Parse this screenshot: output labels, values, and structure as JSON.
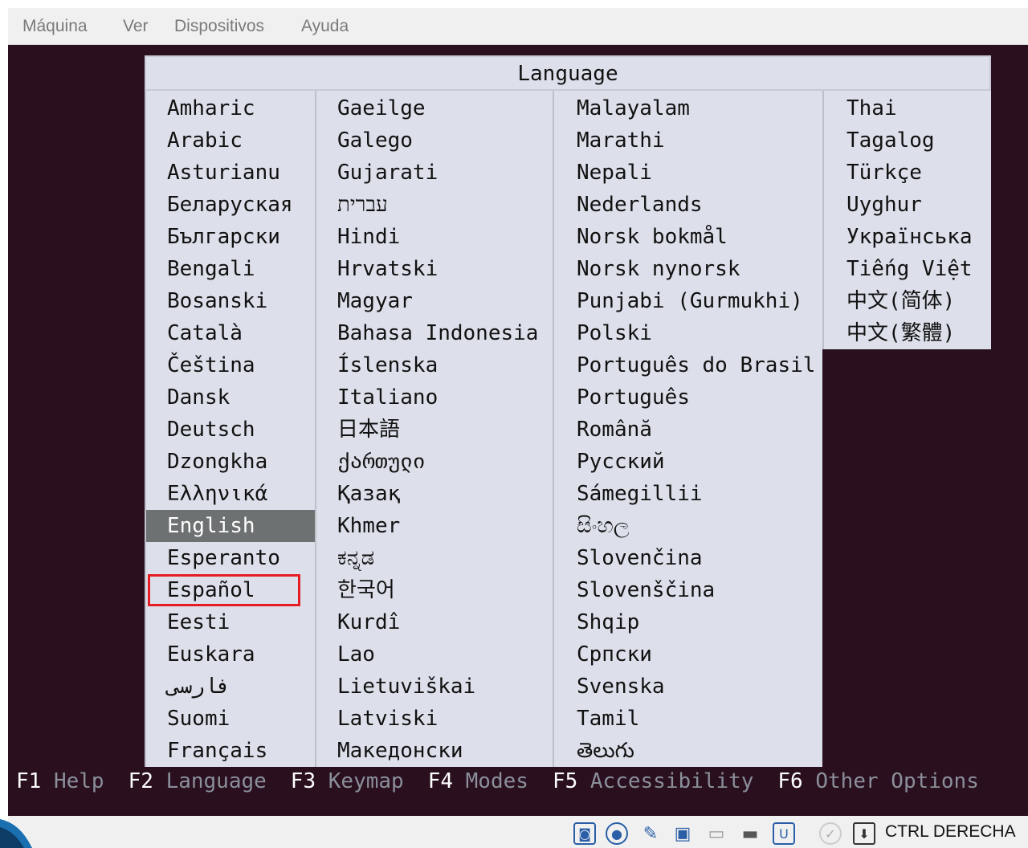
{
  "menubar": {
    "items": [
      "Máquina",
      "Ver",
      "Dispositivos",
      "Ayuda"
    ]
  },
  "dialog": {
    "title": "Language",
    "columns": [
      [
        "Amharic",
        "Arabic",
        "Asturianu",
        "Беларуская",
        "Български",
        "Bengali",
        "Bosanski",
        "Català",
        "Čeština",
        "Dansk",
        "Deutsch",
        "Dzongkha",
        "Ελληνικά",
        "English",
        "Esperanto",
        "Español",
        "Eesti",
        "Euskara",
        "فارسی",
        "Suomi",
        "Français"
      ],
      [
        "Gaeilge",
        "Galego",
        "Gujarati",
        "עברית",
        "Hindi",
        "Hrvatski",
        "Magyar",
        "Bahasa Indonesia",
        "Íslenska",
        "Italiano",
        "日本語",
        "ქართული",
        "Қазақ",
        "Khmer",
        "ಕನ್ನಡ",
        "한국어",
        "Kurdî",
        "Lao",
        "Lietuviškai",
        "Latviski",
        "Македонски"
      ],
      [
        "Malayalam",
        "Marathi",
        "Nepali",
        "Nederlands",
        "Norsk bokmål",
        "Norsk nynorsk",
        "Punjabi (Gurmukhi)",
        "Polski",
        "Português do Brasil",
        "Português",
        "Română",
        "Русский",
        "Sámegillii",
        "සිංහල",
        "Slovenčina",
        "Slovenščina",
        "Shqip",
        "Српски",
        "Svenska",
        "Tamil",
        "తెలుగు"
      ],
      [
        "Thai",
        "Tagalog",
        "Türkçe",
        "Uyghur",
        "Українська",
        "Tiếng Việt",
        "中文(简体)",
        "中文(繁體)"
      ]
    ],
    "selected": "English",
    "highlighted": "Español"
  },
  "function_keys": [
    {
      "key": "F1",
      "label": "Help"
    },
    {
      "key": "F2",
      "label": "Language"
    },
    {
      "key": "F3",
      "label": "Keymap"
    },
    {
      "key": "F4",
      "label": "Modes"
    },
    {
      "key": "F5",
      "label": "Accessibility"
    },
    {
      "key": "F6",
      "label": "Other Options"
    }
  ],
  "statusbar": {
    "icons": [
      "hard-disk-icon",
      "optical-drive-icon",
      "usb-icon",
      "network-icon",
      "shared-folder-icon",
      "display-icon",
      "video-capture-icon",
      "mouse-integration-icon",
      "keyboard-capture-icon"
    ],
    "host_key": "CTRL DERECHA"
  },
  "colors": {
    "screen_bg": "#2a0f1f",
    "dialog_bg": "#dde0ea",
    "selected_bg": "#6e7171",
    "red_box": "#e61c24",
    "fkey_label": "#8a8f9a"
  }
}
